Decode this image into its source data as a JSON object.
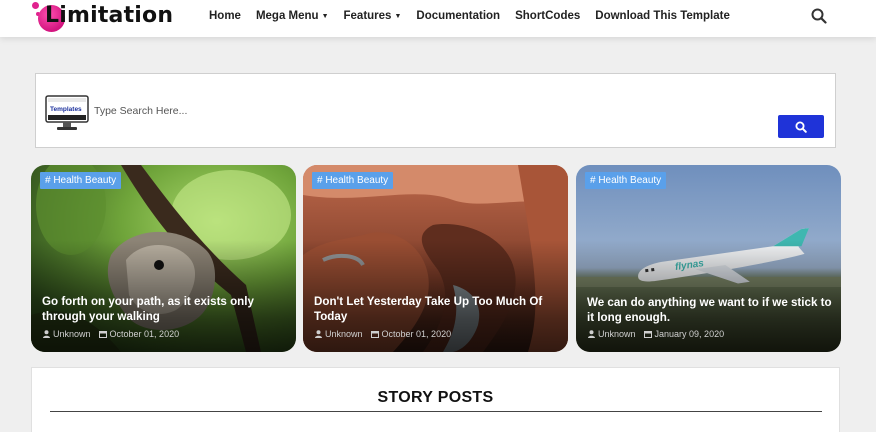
{
  "header": {
    "logo_text": "Limitation",
    "nav": [
      {
        "label": "Home"
      },
      {
        "label": "Mega Menu",
        "caret": "▼"
      },
      {
        "label": "Features",
        "caret": "▼"
      },
      {
        "label": "Documentation"
      },
      {
        "label": "ShortCodes"
      },
      {
        "label": "Download This Template"
      }
    ],
    "search_icon": "search-icon"
  },
  "search": {
    "placeholder": "Type Search Here...",
    "logo_text": "Templates",
    "button_icon": "search-icon"
  },
  "cards": [
    {
      "tag": "# Health Beauty",
      "title": "Go forth on your path, as it exists only through your walking",
      "author": "Unknown",
      "date": "October 01, 2020",
      "image": "chipmunk-on-branch"
    },
    {
      "tag": "# Health Beauty",
      "title": "Don't Let Yesterday Take Up Too Much Of Today",
      "author": "Unknown",
      "date": "October 01, 2020",
      "image": "canyon-river"
    },
    {
      "tag": "# Health Beauty",
      "title": "We can do anything we want to if we stick to it long enough.",
      "author": "Unknown",
      "date": "January 09, 2020",
      "image": "airplane-takeoff",
      "plane_text": "flynas"
    }
  ],
  "story": {
    "title": "STORY POSTS"
  },
  "colors": {
    "accent": "#1f33d8",
    "tag": "#5aa0ea",
    "logo": "#e0228e"
  }
}
